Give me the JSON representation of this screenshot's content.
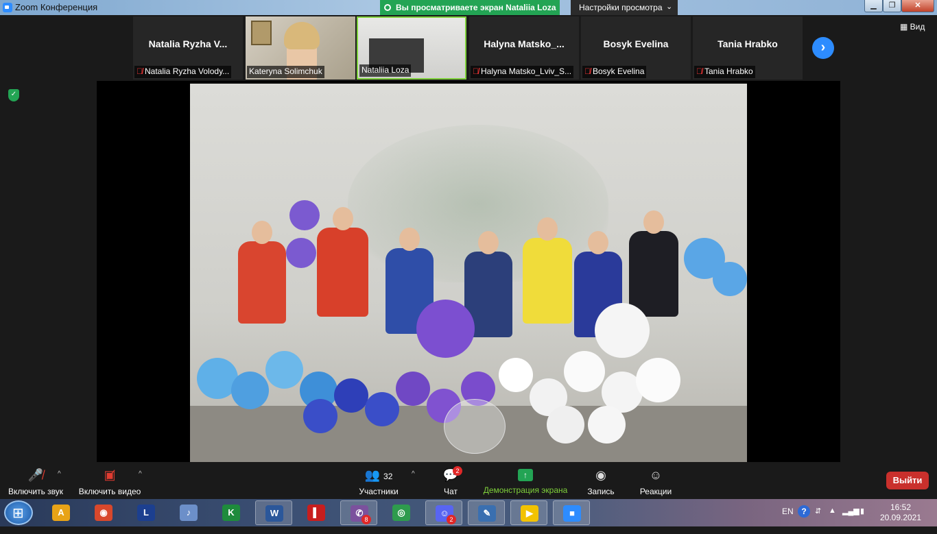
{
  "titlebar": {
    "title": "Zoom Конференция",
    "share_banner": "Вы просматриваете экран Nataliia Loza",
    "view_options": "Настройки просмотра"
  },
  "gallery": {
    "tiles": [
      {
        "name": "Natalia Ryzha V...",
        "label": "Natalia Ryzha Volody...",
        "muted": true,
        "video": false
      },
      {
        "name": "",
        "label": "Kateryna Solimchuk",
        "muted": false,
        "video": true
      },
      {
        "name": "",
        "label": "Nataliia Loza",
        "muted": false,
        "video": true,
        "active": true
      },
      {
        "name": "Halyna  Matsko_...",
        "label": "Halyna Matsko_Lviv_S...",
        "muted": true,
        "video": false
      },
      {
        "name": "Bosyk Evelina",
        "label": "Bosyk Evelina",
        "muted": true,
        "video": false
      },
      {
        "name": "Tania Hrabko",
        "label": "Tania Hrabko",
        "muted": true,
        "video": false
      }
    ],
    "view_label": "Вид"
  },
  "toolbar": {
    "unmute": "Включить звук",
    "start_video": "Включить видео",
    "participants": "Участники",
    "participants_count": "32",
    "chat": "Чат",
    "chat_badge": "2",
    "share_screen": "Демонстрация экрана",
    "record": "Запись",
    "reactions": "Реакции",
    "leave": "Выйти"
  },
  "taskbar": {
    "apps": [
      {
        "icon": "archicad-icon",
        "color": "#e8a317",
        "glyph": "A",
        "badge": ""
      },
      {
        "icon": "screen-recorder-icon",
        "color": "#d8482c",
        "glyph": "◉",
        "badge": ""
      },
      {
        "icon": "ldoce-dictionary-icon",
        "color": "#1c3f8f",
        "glyph": "L",
        "badge": ""
      },
      {
        "icon": "speaker-icon",
        "color": "#6c8fc9",
        "glyph": "♪",
        "badge": ""
      },
      {
        "icon": "kaspersky-icon",
        "color": "#1e8b3c",
        "glyph": "K",
        "badge": ""
      },
      {
        "icon": "word-icon",
        "color": "#2b579a",
        "glyph": "W",
        "badge": ""
      },
      {
        "icon": "red-book-icon",
        "color": "#c81e1e",
        "glyph": "▌",
        "badge": ""
      },
      {
        "icon": "viber-icon",
        "color": "#7b519d",
        "glyph": "✆",
        "badge": "8"
      },
      {
        "icon": "chrome-icon",
        "color": "#2e9b4d",
        "glyph": "◎",
        "badge": ""
      },
      {
        "icon": "discord-icon",
        "color": "#5865f2",
        "glyph": "☺",
        "badge": "2"
      },
      {
        "icon": "presentation-icon",
        "color": "#3a6fb0",
        "glyph": "✎",
        "badge": ""
      },
      {
        "icon": "player-icon",
        "color": "#f2c200",
        "glyph": "▶",
        "badge": ""
      },
      {
        "icon": "zoom-icon",
        "color": "#2d8cff",
        "glyph": "■",
        "badge": ""
      }
    ],
    "lang": "EN",
    "time": "16:52",
    "date": "20.09.2021"
  },
  "colors": {
    "share_green": "#23a454",
    "leave_red": "#c9302c",
    "zoom_blue": "#2d8cff"
  }
}
